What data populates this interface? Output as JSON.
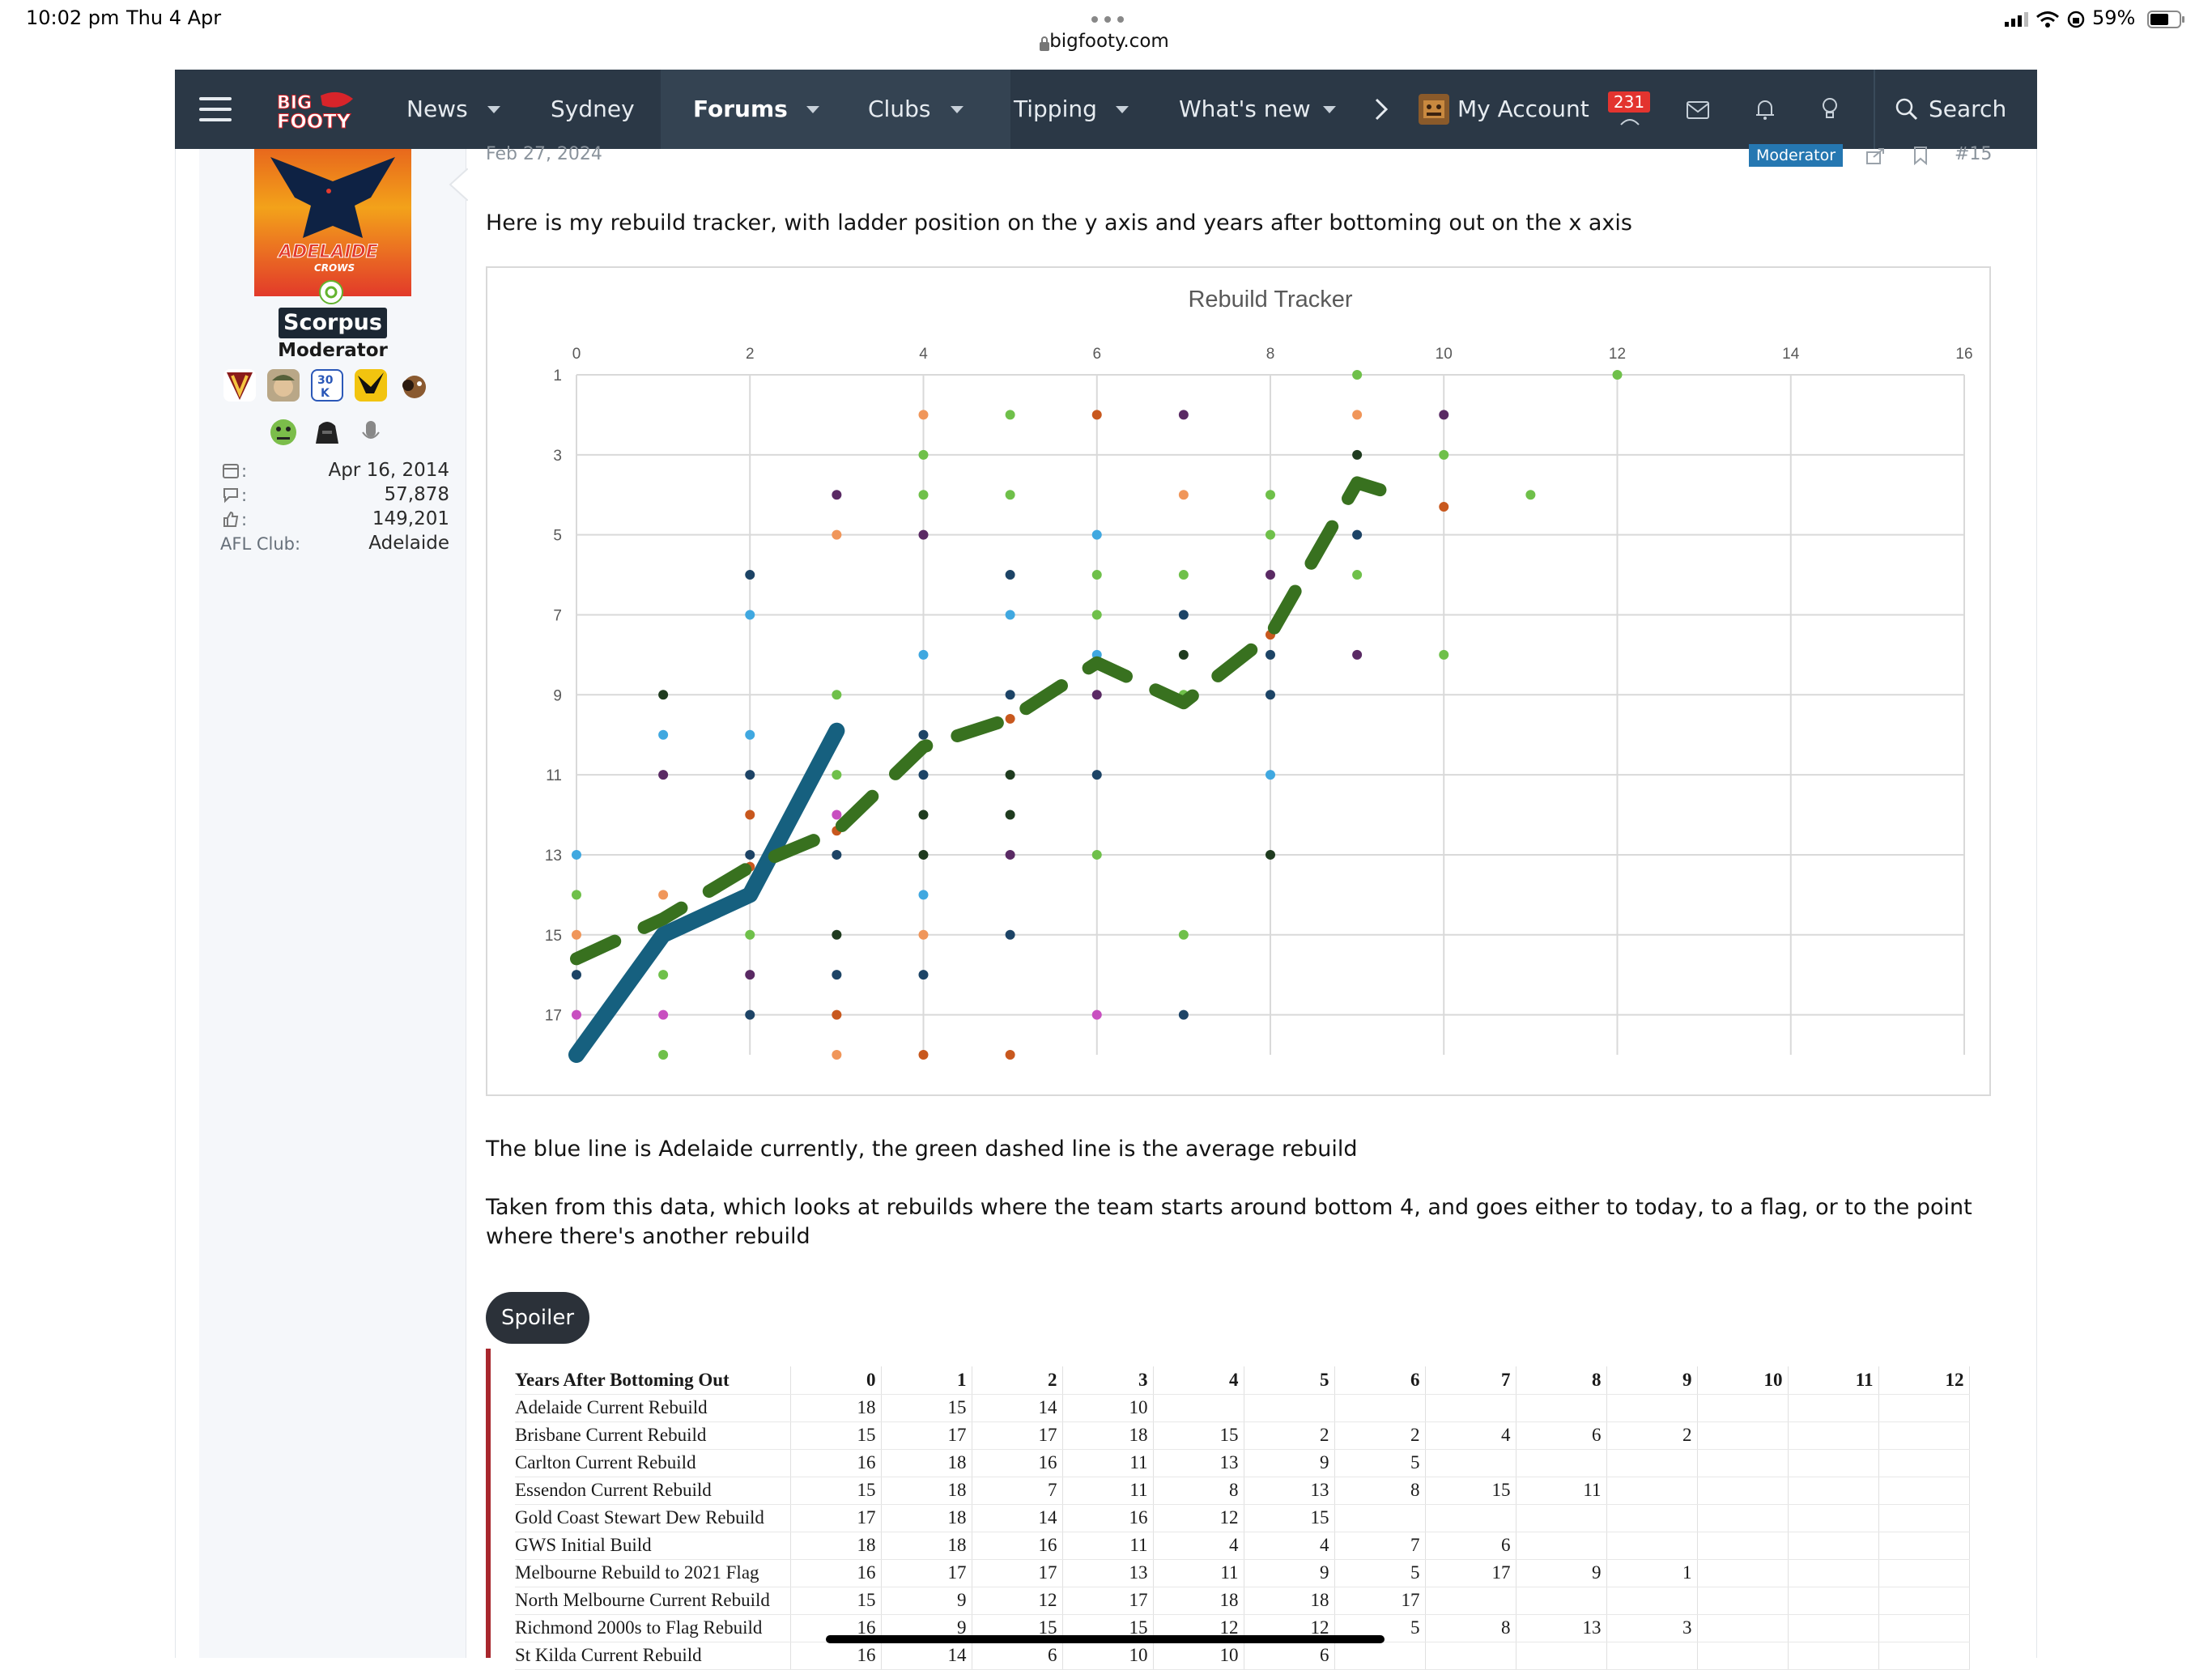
{
  "status_bar": {
    "time": "10:02 pm",
    "date": "Thu 4 Apr",
    "battery": "59%"
  },
  "browser": {
    "url": "bigfooty.com"
  },
  "nav": {
    "logo": "BIG FOOTY",
    "items": [
      "News",
      "Sydney",
      "Forums",
      "Clubs",
      "Tipping",
      "What's new"
    ],
    "account": "My Account",
    "notification_count": "231",
    "search": "Search"
  },
  "user": {
    "name": "Scorpus",
    "role": "Moderator",
    "logo_text": "ADELAIDE",
    "logo_sub": "CROWS",
    "joined": "Apr 16, 2014",
    "messages": "57,878",
    "reactions": "149,201",
    "club_label": "AFL Club:",
    "club": "Adelaide"
  },
  "post": {
    "date": "Feb 27, 2024",
    "moderator_badge": "Moderator",
    "post_number": "#15",
    "intro": "Here is my rebuild tracker, with ladder position on the y axis and years after bottoming out on the x axis",
    "para1": "The blue line is Adelaide currently, the green dashed line is the average rebuild",
    "para2a": "Taken from this data, which looks at rebuilds where the team starts around bottom 4, and goes either to today, to a flag, or to the point",
    "para2b": "where there's another rebuild",
    "spoiler": "Spoiler"
  },
  "chart_data": {
    "type": "scatter",
    "title": "Rebuild Tracker",
    "x_ticks": [
      0,
      2,
      4,
      6,
      8,
      10,
      12,
      14,
      16
    ],
    "y_ticks": [
      1,
      3,
      5,
      7,
      9,
      11,
      13,
      15,
      17
    ],
    "xlim": [
      0,
      16
    ],
    "ylim": [
      1,
      18
    ],
    "y_reversed": true,
    "x_axis_position": "top",
    "grid": true,
    "colors": {
      "orange": "#f0965a",
      "lightgreen": "#6fc04a",
      "purple": "#5a2a64",
      "darkgreen": "#1f3b1f",
      "navy": "#1d4466",
      "skyblue": "#40a8e0",
      "rust": "#c8581e",
      "magenta": "#c84fc0",
      "adelaide": "#16607f",
      "average": "#38711f"
    },
    "points": [
      {
        "x": 0,
        "y": 13,
        "c": "skyblue"
      },
      {
        "x": 0,
        "y": 14,
        "c": "lightgreen"
      },
      {
        "x": 0,
        "y": 15,
        "c": "orange"
      },
      {
        "x": 0,
        "y": 15.6,
        "c": "rust"
      },
      {
        "x": 0,
        "y": 16,
        "c": "navy"
      },
      {
        "x": 0,
        "y": 17,
        "c": "magenta"
      },
      {
        "x": 0,
        "y": 18,
        "c": "lightgreen"
      },
      {
        "x": 1,
        "y": 9,
        "c": "darkgreen"
      },
      {
        "x": 1,
        "y": 10,
        "c": "skyblue"
      },
      {
        "x": 1,
        "y": 11,
        "c": "purple"
      },
      {
        "x": 1,
        "y": 14,
        "c": "orange"
      },
      {
        "x": 1,
        "y": 14.6,
        "c": "rust"
      },
      {
        "x": 1,
        "y": 16,
        "c": "lightgreen"
      },
      {
        "x": 1,
        "y": 17,
        "c": "magenta"
      },
      {
        "x": 1,
        "y": 18,
        "c": "lightgreen"
      },
      {
        "x": 2,
        "y": 6,
        "c": "navy"
      },
      {
        "x": 2,
        "y": 7,
        "c": "skyblue"
      },
      {
        "x": 2,
        "y": 10,
        "c": "skyblue"
      },
      {
        "x": 2,
        "y": 11,
        "c": "navy"
      },
      {
        "x": 2,
        "y": 12,
        "c": "rust"
      },
      {
        "x": 2,
        "y": 13,
        "c": "navy"
      },
      {
        "x": 2,
        "y": 13.3,
        "c": "rust"
      },
      {
        "x": 2,
        "y": 14,
        "c": "magenta"
      },
      {
        "x": 2,
        "y": 15,
        "c": "lightgreen"
      },
      {
        "x": 2,
        "y": 16,
        "c": "purple"
      },
      {
        "x": 2,
        "y": 17,
        "c": "navy"
      },
      {
        "x": 3,
        "y": 4,
        "c": "purple"
      },
      {
        "x": 3,
        "y": 5,
        "c": "orange"
      },
      {
        "x": 3,
        "y": 9,
        "c": "lightgreen"
      },
      {
        "x": 3,
        "y": 11,
        "c": "lightgreen"
      },
      {
        "x": 3,
        "y": 12,
        "c": "magenta"
      },
      {
        "x": 3,
        "y": 12.4,
        "c": "rust"
      },
      {
        "x": 3,
        "y": 13,
        "c": "navy"
      },
      {
        "x": 3,
        "y": 15,
        "c": "darkgreen"
      },
      {
        "x": 3,
        "y": 16,
        "c": "navy"
      },
      {
        "x": 3,
        "y": 17,
        "c": "rust"
      },
      {
        "x": 3,
        "y": 18,
        "c": "orange"
      },
      {
        "x": 4,
        "y": 2,
        "c": "orange"
      },
      {
        "x": 4,
        "y": 3,
        "c": "lightgreen"
      },
      {
        "x": 4,
        "y": 4,
        "c": "lightgreen"
      },
      {
        "x": 4,
        "y": 5,
        "c": "purple"
      },
      {
        "x": 4,
        "y": 8,
        "c": "skyblue"
      },
      {
        "x": 4,
        "y": 10,
        "c": "navy"
      },
      {
        "x": 4,
        "y": 10.3,
        "c": "rust"
      },
      {
        "x": 4,
        "y": 11,
        "c": "navy"
      },
      {
        "x": 4,
        "y": 12,
        "c": "darkgreen"
      },
      {
        "x": 4,
        "y": 13,
        "c": "darkgreen"
      },
      {
        "x": 4,
        "y": 14,
        "c": "skyblue"
      },
      {
        "x": 4,
        "y": 15,
        "c": "orange"
      },
      {
        "x": 4,
        "y": 16,
        "c": "navy"
      },
      {
        "x": 4,
        "y": 18,
        "c": "rust"
      },
      {
        "x": 5,
        "y": 2,
        "c": "lightgreen"
      },
      {
        "x": 5,
        "y": 4,
        "c": "lightgreen"
      },
      {
        "x": 5,
        "y": 6,
        "c": "navy"
      },
      {
        "x": 5,
        "y": 7,
        "c": "skyblue"
      },
      {
        "x": 5,
        "y": 9,
        "c": "navy"
      },
      {
        "x": 5,
        "y": 9.6,
        "c": "rust"
      },
      {
        "x": 5,
        "y": 11,
        "c": "darkgreen"
      },
      {
        "x": 5,
        "y": 12,
        "c": "darkgreen"
      },
      {
        "x": 5,
        "y": 13,
        "c": "purple"
      },
      {
        "x": 5,
        "y": 15,
        "c": "navy"
      },
      {
        "x": 5,
        "y": 18,
        "c": "rust"
      },
      {
        "x": 6,
        "y": 2,
        "c": "rust"
      },
      {
        "x": 6,
        "y": 5,
        "c": "skyblue"
      },
      {
        "x": 6,
        "y": 6,
        "c": "lightgreen"
      },
      {
        "x": 6,
        "y": 7,
        "c": "lightgreen"
      },
      {
        "x": 6,
        "y": 8,
        "c": "skyblue"
      },
      {
        "x": 6,
        "y": 8.2,
        "c": "rust"
      },
      {
        "x": 6,
        "y": 9,
        "c": "purple"
      },
      {
        "x": 6,
        "y": 11,
        "c": "navy"
      },
      {
        "x": 6,
        "y": 13,
        "c": "lightgreen"
      },
      {
        "x": 6,
        "y": 17,
        "c": "magenta"
      },
      {
        "x": 7,
        "y": 2,
        "c": "purple"
      },
      {
        "x": 7,
        "y": 4,
        "c": "orange"
      },
      {
        "x": 7,
        "y": 6,
        "c": "lightgreen"
      },
      {
        "x": 7,
        "y": 7,
        "c": "navy"
      },
      {
        "x": 7,
        "y": 8,
        "c": "darkgreen"
      },
      {
        "x": 7,
        "y": 9,
        "c": "lightgreen"
      },
      {
        "x": 7,
        "y": 15,
        "c": "lightgreen"
      },
      {
        "x": 7,
        "y": 17,
        "c": "navy"
      },
      {
        "x": 8,
        "y": 4,
        "c": "lightgreen"
      },
      {
        "x": 8,
        "y": 5,
        "c": "lightgreen"
      },
      {
        "x": 8,
        "y": 6,
        "c": "purple"
      },
      {
        "x": 8,
        "y": 7.5,
        "c": "rust"
      },
      {
        "x": 8,
        "y": 8,
        "c": "navy"
      },
      {
        "x": 8,
        "y": 9,
        "c": "navy"
      },
      {
        "x": 8,
        "y": 11,
        "c": "skyblue"
      },
      {
        "x": 8,
        "y": 13,
        "c": "darkgreen"
      },
      {
        "x": 9,
        "y": 1,
        "c": "lightgreen"
      },
      {
        "x": 9,
        "y": 2,
        "c": "orange"
      },
      {
        "x": 9,
        "y": 3,
        "c": "darkgreen"
      },
      {
        "x": 9,
        "y": 3.7,
        "c": "rust"
      },
      {
        "x": 9,
        "y": 5,
        "c": "navy"
      },
      {
        "x": 9,
        "y": 6,
        "c": "lightgreen"
      },
      {
        "x": 9,
        "y": 8,
        "c": "purple"
      },
      {
        "x": 10,
        "y": 2,
        "c": "purple"
      },
      {
        "x": 10,
        "y": 3,
        "c": "lightgreen"
      },
      {
        "x": 10,
        "y": 4.3,
        "c": "rust"
      },
      {
        "x": 10,
        "y": 8,
        "c": "lightgreen"
      },
      {
        "x": 11,
        "y": 4,
        "c": "lightgreen"
      },
      {
        "x": 12,
        "y": 1,
        "c": "lightgreen"
      }
    ],
    "series": [
      {
        "c": "adelaide",
        "x": [
          0,
          1,
          2,
          3
        ],
        "y": [
          18,
          15,
          14,
          9.9
        ]
      },
      {
        "c": "average",
        "dashed": true,
        "x": [
          0,
          1,
          2,
          3,
          4,
          5,
          6,
          7,
          8,
          9,
          9.6
        ],
        "y": [
          15.6,
          14.6,
          13.3,
          12.4,
          10.3,
          9.6,
          8.2,
          9.2,
          7.5,
          3.7,
          4.1
        ]
      }
    ]
  },
  "table": {
    "header": [
      "Years After Bottoming Out",
      "0",
      "1",
      "2",
      "3",
      "4",
      "5",
      "6",
      "7",
      "8",
      "9",
      "10",
      "11",
      "12"
    ],
    "rows": [
      [
        "Adelaide Current Rebuild",
        "18",
        "15",
        "14",
        "10",
        "",
        "",
        "",
        "",
        "",
        "",
        "",
        "",
        ""
      ],
      [
        "Brisbane Current Rebuild",
        "15",
        "17",
        "17",
        "18",
        "15",
        "2",
        "2",
        "4",
        "6",
        "2",
        "",
        "",
        ""
      ],
      [
        "Carlton Current Rebuild",
        "16",
        "18",
        "16",
        "11",
        "13",
        "9",
        "5",
        "",
        "",
        "",
        "",
        "",
        ""
      ],
      [
        "Essendon Current Rebuild",
        "15",
        "18",
        "7",
        "11",
        "8",
        "13",
        "8",
        "15",
        "11",
        "",
        "",
        "",
        ""
      ],
      [
        "Gold Coast Stewart Dew Rebuild",
        "17",
        "18",
        "14",
        "16",
        "12",
        "15",
        "",
        "",
        "",
        "",
        "",
        "",
        ""
      ],
      [
        "GWS Initial Build",
        "18",
        "18",
        "16",
        "11",
        "4",
        "4",
        "7",
        "6",
        "",
        "",
        "",
        "",
        ""
      ],
      [
        "Melbourne Rebuild to 2021 Flag",
        "16",
        "17",
        "17",
        "13",
        "11",
        "9",
        "5",
        "17",
        "9",
        "1",
        "",
        "",
        ""
      ],
      [
        "North Melbourne Current Rebuild",
        "15",
        "9",
        "12",
        "17",
        "18",
        "18",
        "17",
        "",
        "",
        "",
        "",
        "",
        ""
      ],
      [
        "Richmond 2000s to Flag Rebuild",
        "16",
        "9",
        "15",
        "15",
        "12",
        "12",
        "5",
        "8",
        "13",
        "3",
        "",
        "",
        ""
      ],
      [
        "St Kilda Current Rebuild",
        "16",
        "14",
        "6",
        "10",
        "10",
        "6",
        "",
        "",
        "",
        "",
        "",
        "",
        ""
      ]
    ]
  }
}
